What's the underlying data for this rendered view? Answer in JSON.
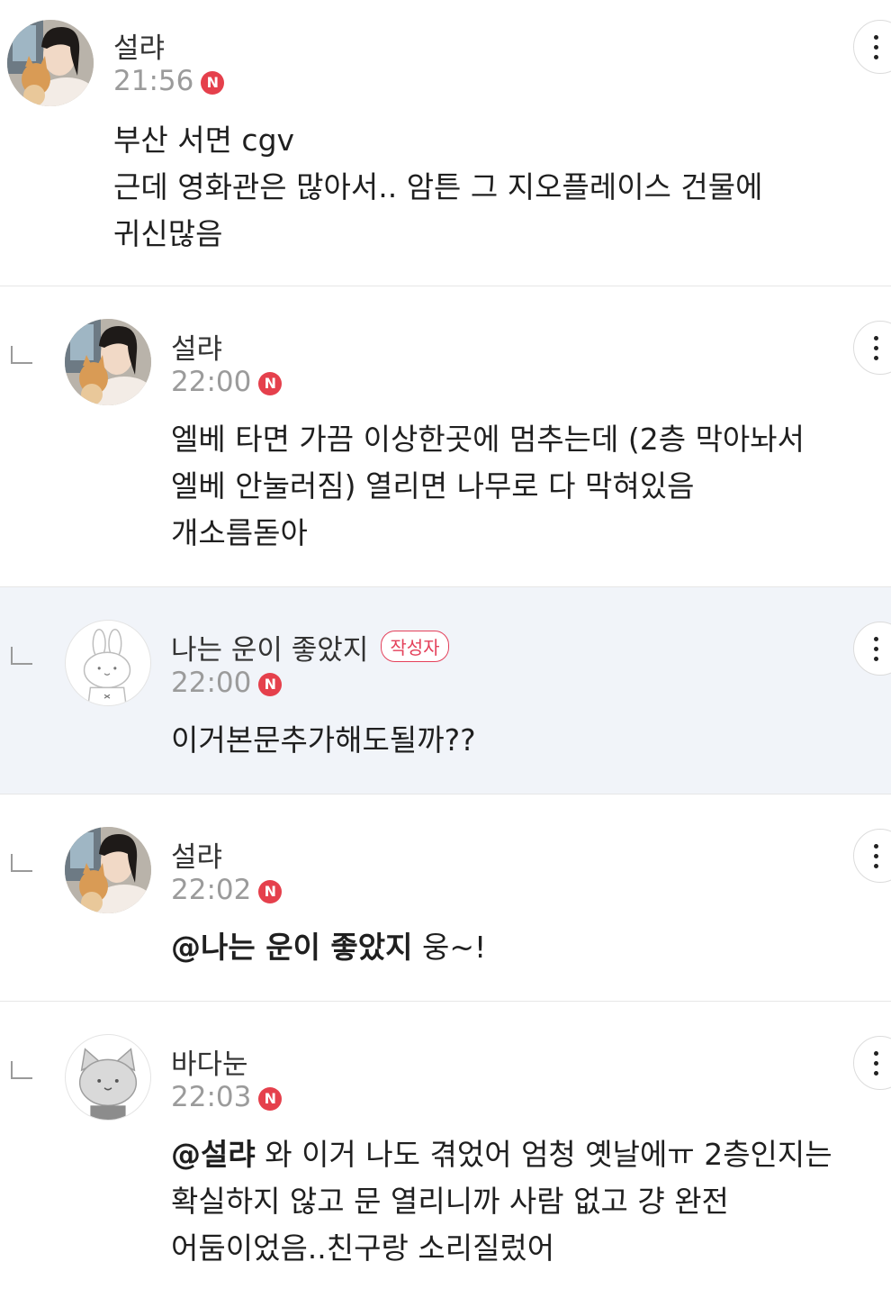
{
  "comments": [
    {
      "author": "설랴",
      "time": "21:56",
      "new_badge": "N",
      "body": "부산 서면 cgv\n근데 영화관은 많아서.. 암튼 그 지오플레이스 건물에\n귀신많음",
      "avatar": "user-photo-with-cat"
    },
    {
      "author": "설랴",
      "time": "22:00",
      "new_badge": "N",
      "body": "엘베 타면 가끔 이상한곳에 멈추는데 (2층 막아놔서\n엘베 안눌러짐) 열리면 나무로 다 막혀있음\n개소름돋아",
      "avatar": "user-photo-with-cat"
    },
    {
      "author": "나는 운이 좋았지",
      "author_badge": "작성자",
      "time": "22:00",
      "new_badge": "N",
      "body": "이거본문추가해도될까??",
      "avatar": "default-rabbit"
    },
    {
      "author": "설랴",
      "time": "22:02",
      "new_badge": "N",
      "mention": "@나는 운이 좋았지",
      "body": " 웅~!",
      "avatar": "user-photo-with-cat"
    },
    {
      "author": "바다눈",
      "time": "22:03",
      "new_badge": "N",
      "mention": "@설랴",
      "body": " 와 이거 나도 겪었어 엄청 옛날에ㅠ 2층인지는\n확실하지 않고 문 열리니까 사람 없고 걍 완전\n어둠이었음..친구랑 소리질렀어",
      "avatar": "default-cat"
    }
  ],
  "colors": {
    "highlight_bg": "#f1f4f9",
    "new_badge": "#e5404c",
    "author_badge": "#e4405a",
    "time_text": "#9b9b9b"
  }
}
